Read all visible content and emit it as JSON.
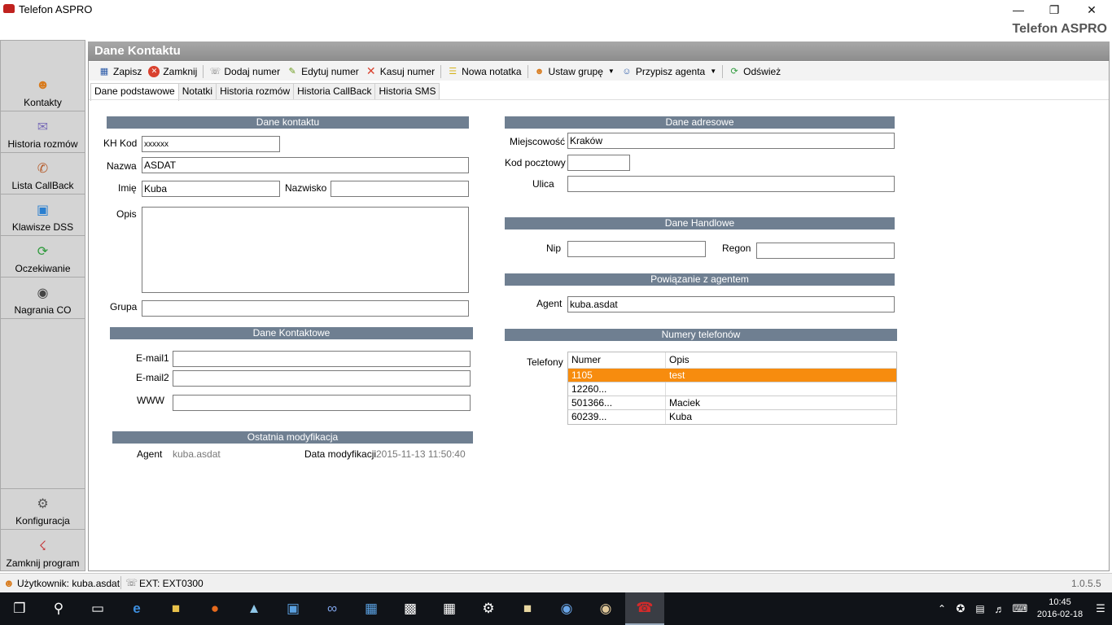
{
  "window": {
    "title": "Telefon ASPRO",
    "brand": "Telefon ASPRO"
  },
  "nav": {
    "items": [
      {
        "label": "Kontakty",
        "icon": "contacts-icon"
      },
      {
        "label": "Historia rozmów",
        "icon": "chat-history-icon"
      },
      {
        "label": "Lista CallBack",
        "icon": "phone-callback-icon"
      },
      {
        "label": "Klawisze DSS",
        "icon": "monitor-icon"
      },
      {
        "label": "Oczekiwanie",
        "icon": "waiting-icon"
      },
      {
        "label": "Nagrania CO",
        "icon": "recording-icon"
      }
    ],
    "bottom": [
      {
        "label": "Konfiguracja",
        "icon": "config-icon"
      },
      {
        "label": "Zamknij program",
        "icon": "exit-icon"
      }
    ]
  },
  "panel": {
    "title": "Dane Kontaktu"
  },
  "toolbar": {
    "save": "Zapisz",
    "close": "Zamknij",
    "add_number": "Dodaj numer",
    "edit_number": "Edytuj numer",
    "delete_number": "Kasuj numer",
    "new_note": "Nowa notatka",
    "set_group": "Ustaw grupę",
    "assign_agent": "Przypisz agenta",
    "refresh": "Odśwież"
  },
  "tabs": [
    "Dane podstawowe",
    "Notatki",
    "Historia rozmów",
    "Historia CallBack",
    "Historia SMS"
  ],
  "contact": {
    "section": "Dane kontaktu",
    "kh_label": "KH Kod",
    "kh_value": "xxxxxx",
    "name_label": "Nazwa",
    "name_value": "ASDAT",
    "first_label": "Imię",
    "first_value": "Kuba",
    "last_label": "Nazwisko",
    "last_value": "",
    "desc_label": "Opis",
    "desc_value": "",
    "group_label": "Grupa",
    "group_value": ""
  },
  "contacts": {
    "section": "Dane Kontaktowe",
    "email1_label": "E-mail1",
    "email1_value": "",
    "email2_label": "E-mail2",
    "email2_value": "",
    "www_label": "WWW",
    "www_value": ""
  },
  "modified": {
    "section": "Ostatnia modyfikacja",
    "agent_label": "Agent",
    "agent_value": "kuba.asdat",
    "date_label": "Data modyfikacji",
    "date_value": "2015-11-13 11:50:40"
  },
  "address": {
    "section": "Dane adresowe",
    "city_label": "Miejscowość",
    "city_value": "Kraków",
    "zip_label": "Kod pocztowy",
    "zip_value": "",
    "street_label": "Ulica",
    "street_value": ""
  },
  "trade": {
    "section": "Dane Handlowe",
    "nip_label": "Nip",
    "nip_value": "",
    "regon_label": "Regon",
    "regon_value": ""
  },
  "agent_link": {
    "section": "Powiązanie z agentem",
    "agent_label": "Agent",
    "agent_value": "kuba.asdat"
  },
  "phones": {
    "section": "Numery telefonów",
    "label": "Telefony",
    "col_number": "Numer",
    "col_desc": "Opis",
    "rows": [
      {
        "number": "1105",
        "desc": "test"
      },
      {
        "number": "12260...",
        "desc": ""
      },
      {
        "number": "501366...",
        "desc": "Maciek"
      },
      {
        "number": "60239...",
        "desc": "Kuba"
      }
    ]
  },
  "status": {
    "user": "Użytkownik: kuba.asdat",
    "ext": "EXT: EXT0300",
    "version": "1.0.5.5"
  },
  "taskbar": {
    "time": "10:45",
    "date": "2016-02-18"
  },
  "colors": {
    "section_bg": "#6f7f91",
    "selected_row": "#f78c0e",
    "taskbar": "#101318"
  }
}
